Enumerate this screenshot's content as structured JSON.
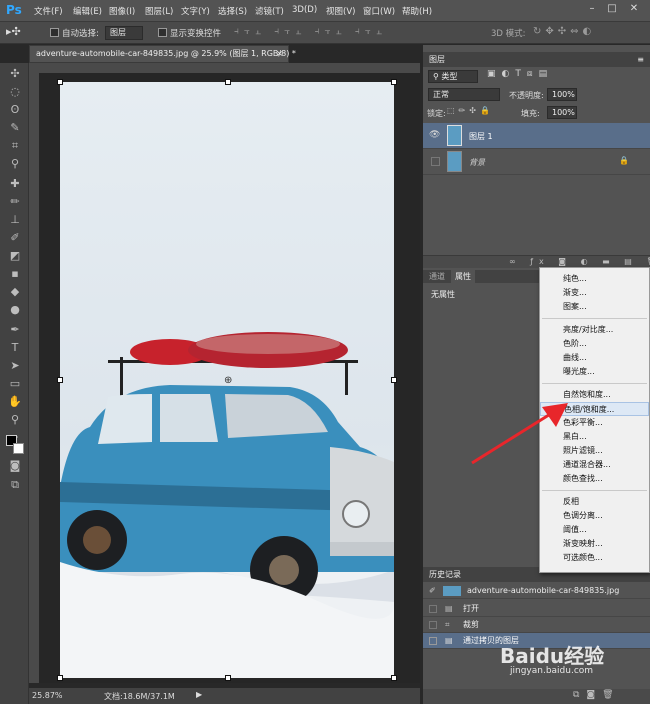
{
  "app": {
    "logo": "Ps",
    "accent": "#31a8ff"
  },
  "menubar": {
    "items": [
      "文件(F)",
      "编辑(E)",
      "图像(I)",
      "图层(L)",
      "文字(Y)",
      "选择(S)",
      "滤镜(T)",
      "3D(D)",
      "视图(V)",
      "窗口(W)",
      "帮助(H)"
    ],
    "window_buttons": [
      "–",
      "□",
      "✕"
    ]
  },
  "options": {
    "auto_select_label": "自动选择:",
    "auto_select_value": "图层",
    "show_transform_label": "显示变换控件",
    "mode_3d_label": "3D 模式:"
  },
  "document": {
    "tab_title": "adventure-automobile-car-849835.jpg @ 25.9% (图层 1, RGB/8) *",
    "tab_close": "×"
  },
  "status": {
    "zoom": "25.87%",
    "doc_size": "文档:18.6M/37.1M"
  },
  "layers_panel": {
    "title": "图层",
    "filter_type": "类型",
    "blend_mode": "正常",
    "opacity_label": "不透明度:",
    "opacity_value": "100%",
    "lock_label": "锁定:",
    "fill_label": "填充:",
    "fill_value": "100%",
    "layers": [
      {
        "name": "图层 1",
        "selected": true,
        "visible": true
      },
      {
        "name": "背景",
        "selected": false,
        "visible": false
      }
    ]
  },
  "properties_panel": {
    "tabs": [
      "通道",
      "属性"
    ],
    "active_tab": "属性",
    "no_properties": "无属性"
  },
  "adjustment_menu": {
    "groups": [
      [
        "纯色...",
        "渐变...",
        "图案..."
      ],
      [
        "亮度/对比度...",
        "色阶...",
        "曲线...",
        "曝光度..."
      ],
      [
        "自然饱和度...",
        "色相/饱和度...",
        "色彩平衡...",
        "黑白...",
        "照片滤镜...",
        "通道混合器...",
        "颜色查找..."
      ],
      [
        "反相",
        "色调分离...",
        "阈值...",
        "渐变映射...",
        "可选颜色..."
      ]
    ],
    "highlighted": "色相/饱和度...",
    "arrow_color": "#e8262b"
  },
  "history_panel": {
    "title": "历史记录",
    "snapshot": "adventure-automobile-car-849835.jpg",
    "steps": [
      "打开",
      "裁剪",
      "通过拷贝的图层"
    ]
  },
  "watermark": {
    "brand": "Baidu经验",
    "url": "jingyan.baidu.com"
  }
}
